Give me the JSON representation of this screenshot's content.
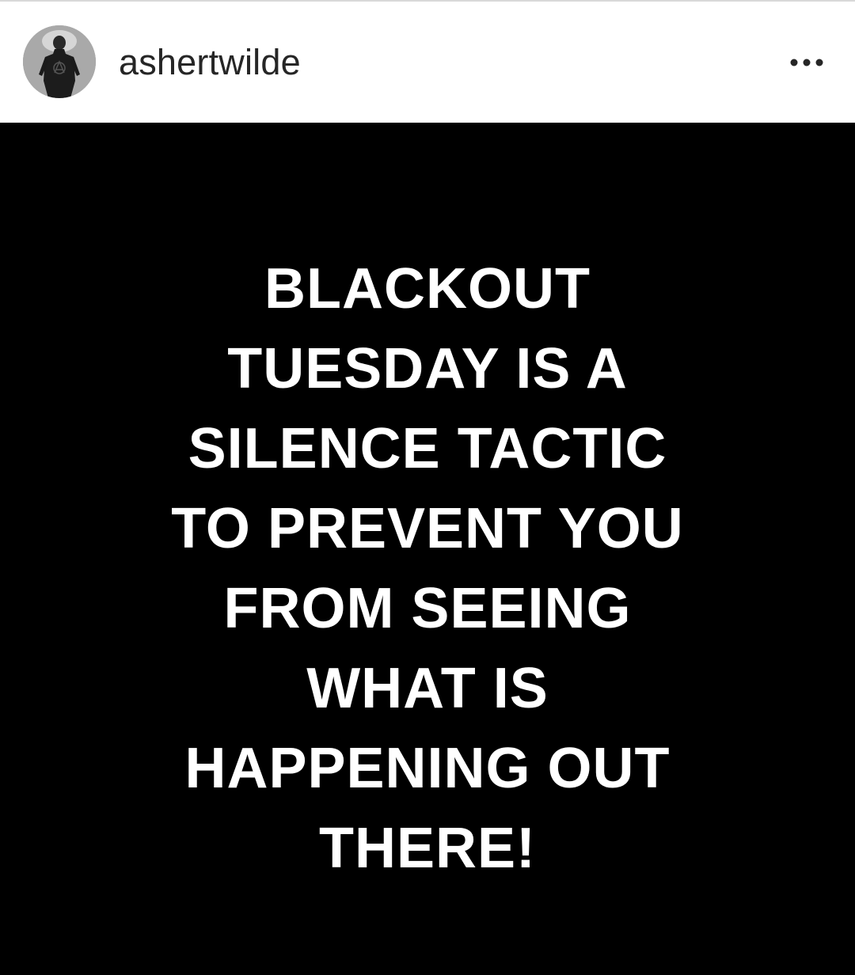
{
  "header": {
    "username": "ashertwilde",
    "avatar_icon": "profile-photo-avatar",
    "more_icon": "more-options-icon"
  },
  "post": {
    "text_lines": [
      "BLACKOUT",
      "TUESDAY IS A",
      "SILENCE TACTIC",
      "TO PREVENT YOU",
      "FROM SEEING",
      "WHAT IS",
      "HAPPENING OUT",
      "THERE!"
    ],
    "background_color": "#000000",
    "text_color": "#ffffff"
  }
}
